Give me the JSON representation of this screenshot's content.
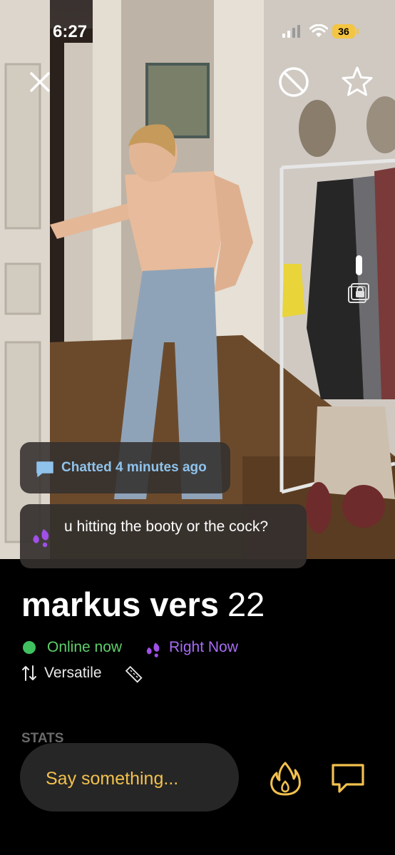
{
  "status_bar": {
    "time": "6:27",
    "battery": "36"
  },
  "top_actions": {
    "close_icon": "close-icon",
    "block_icon": "block-icon",
    "favorite_icon": "star-icon"
  },
  "chat_status": {
    "icon": "chat-bubble-icon",
    "text": "Chatted 4 minutes ago",
    "color": "#8fc3ec"
  },
  "last_message": {
    "icon": "drops-icon",
    "text": "u hitting the booty or the cock?"
  },
  "profile": {
    "name": "markus vers",
    "age": "22",
    "online_text": "Online now",
    "online_color": "#40c160",
    "right_now_text": "Right Now",
    "right_now_color": "#a86cf4",
    "position": "Versatile"
  },
  "stats": {
    "label": "STATS"
  },
  "composer": {
    "placeholder": "Say something...",
    "accent": "#f2c14d"
  }
}
